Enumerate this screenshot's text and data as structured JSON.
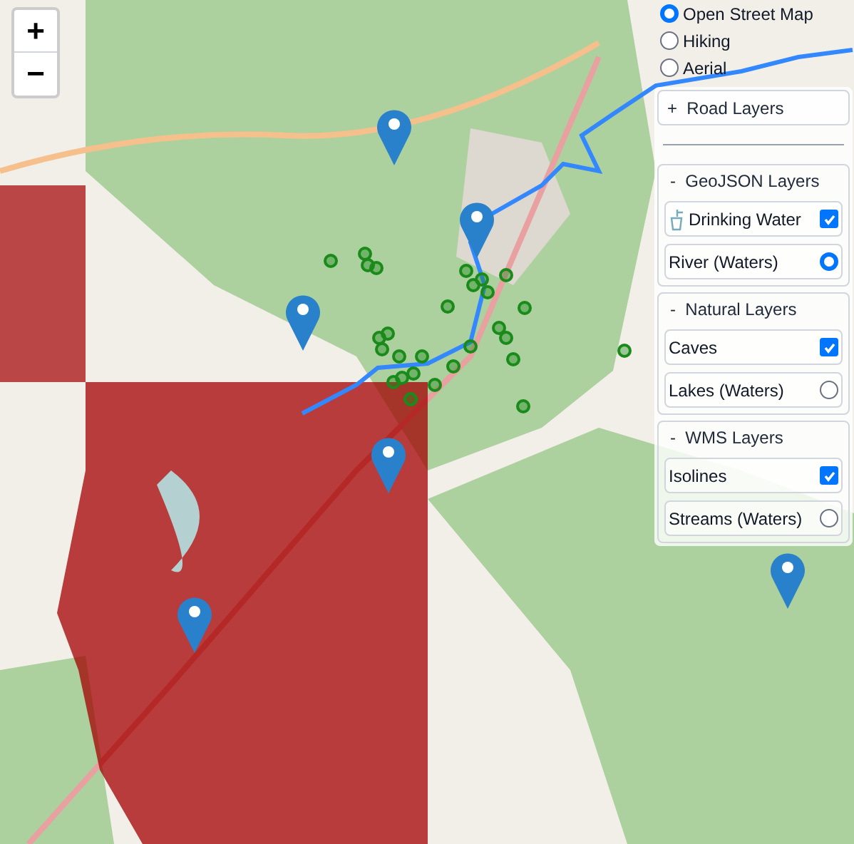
{
  "zoom_controls": [
    {
      "label": "+"
    },
    {
      "label": "−"
    }
  ],
  "base_layers": [
    {
      "label": "Open Street Map",
      "selected": true
    },
    {
      "label": "Hiking",
      "selected": false
    },
    {
      "label": "Aerial",
      "selected": false
    }
  ],
  "collapsed_group": {
    "toggle": "+",
    "label": "Road Layers"
  },
  "groups": [
    {
      "toggle": "-",
      "label": "GeoJSON Layers",
      "items": [
        {
          "kind": "icon_checkbox",
          "label": "Drinking Water",
          "checked": true
        },
        {
          "kind": "radio",
          "label": "River (Waters)",
          "selected": true
        }
      ]
    },
    {
      "toggle": "-",
      "label": "Natural Layers",
      "items": [
        {
          "kind": "checkbox",
          "label": "Caves",
          "checked": true
        },
        {
          "kind": "radio",
          "label": "Lakes (Waters)",
          "selected": false
        }
      ]
    },
    {
      "toggle": "-",
      "label": "WMS Layers",
      "items": [
        {
          "kind": "checkbox",
          "label": "Isolines",
          "checked": true
        },
        {
          "kind": "radio",
          "label": "Streams (Waters)",
          "selected": false
        }
      ]
    }
  ]
}
